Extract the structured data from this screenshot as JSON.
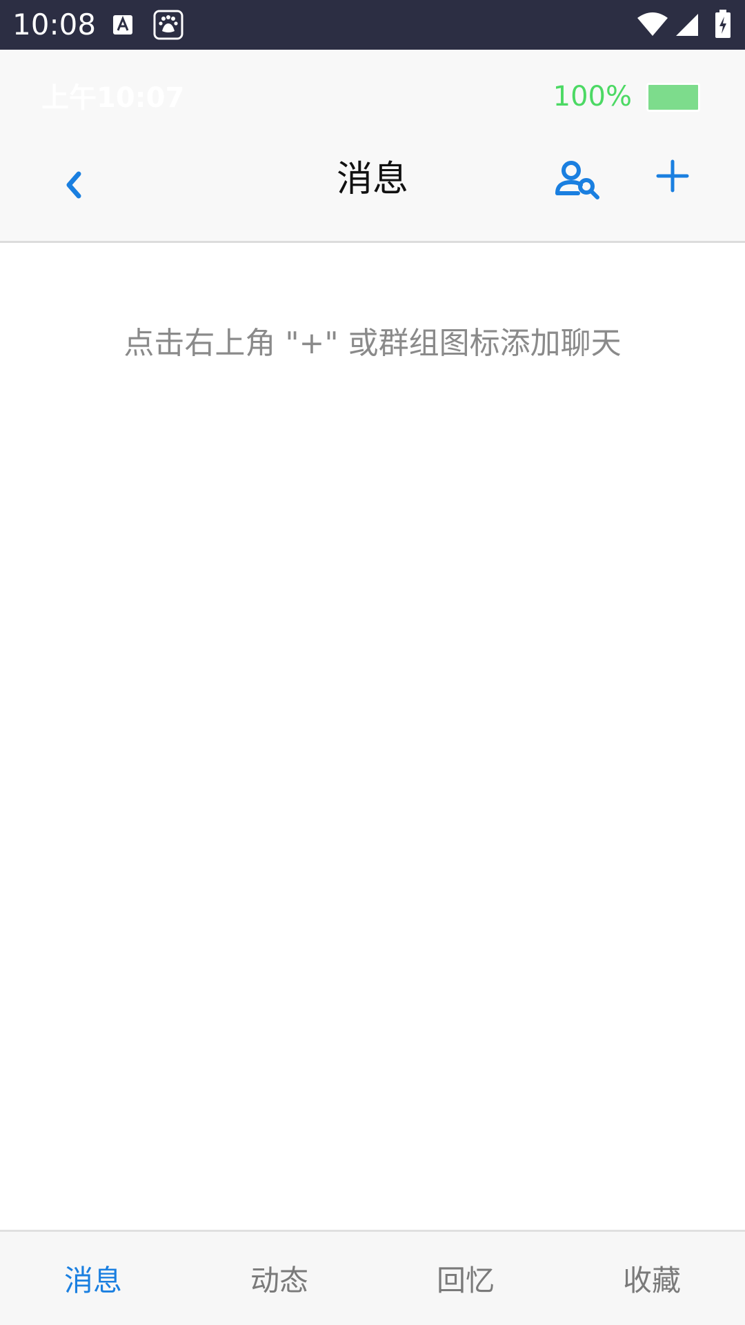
{
  "system_status": {
    "time": "10:08",
    "icons": [
      "a-font-icon",
      "baidu-paw-icon",
      "wifi-icon",
      "cell-signal-icon",
      "battery-charging-icon"
    ]
  },
  "app_status": {
    "time": "上午10:07",
    "battery_percent_label": "100%",
    "battery_level": 1.0
  },
  "nav": {
    "back_icon": "chevron-left-icon",
    "title": "消息",
    "user_search_icon": "user-search-icon",
    "add_icon": "plus-icon"
  },
  "main": {
    "empty_hint": "点击右上角 \"+\" 或群组图标添加聊天"
  },
  "tabs": [
    {
      "label": "消息",
      "active": true
    },
    {
      "label": "动态",
      "active": false
    },
    {
      "label": "回忆",
      "active": false
    },
    {
      "label": "收藏",
      "active": false
    }
  ],
  "colors": {
    "accent": "#1a7fe0",
    "system_bar": "#2c2e43",
    "battery_green": "#4cd964",
    "hint_text": "#8a8a8a"
  }
}
